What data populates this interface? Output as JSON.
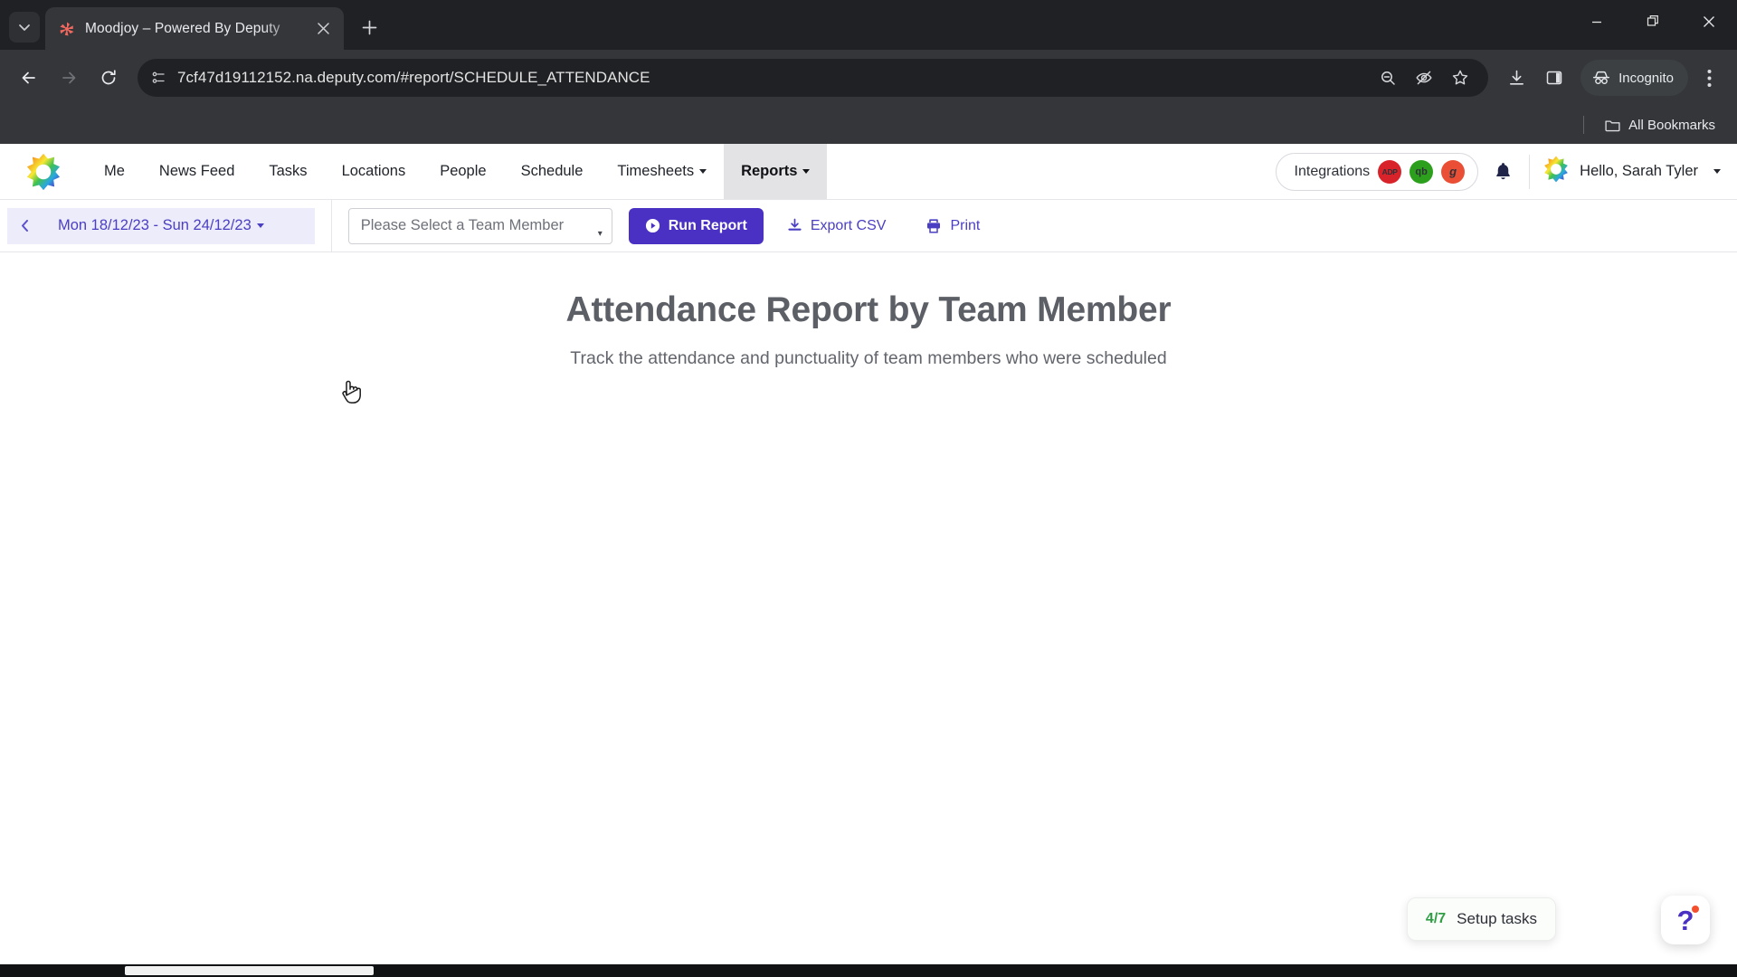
{
  "browser": {
    "tab": {
      "title": "Moodjoy – Powered By Deputy",
      "favicon": "moodjoy-pinwheel-icon",
      "close_label": "×"
    },
    "tab_list_icon": "chevron-down-icon",
    "new_tab_label": "+",
    "window_controls": {
      "minimize": "minimize-icon",
      "maximize": "restore-icon",
      "close": "close-icon"
    },
    "nav": {
      "back": "back-arrow-icon",
      "forward": "forward-arrow-icon",
      "reload": "reload-icon"
    },
    "omnibox": {
      "site_icon": "page-info-icon",
      "url": "7cf47d19112152.na.deputy.com/#report/SCHEDULE_ATTENDANCE",
      "actions": [
        "zoom-out-icon",
        "eye-slash-icon",
        "bookmark-star-icon"
      ]
    },
    "toolbar_actions": [
      "download-icon",
      "side-panel-icon"
    ],
    "profile": {
      "label": "Incognito",
      "icon": "incognito-icon"
    },
    "menu_icon": "three-dots-menu-icon",
    "bookmarks": {
      "folder_icon": "folder-icon",
      "label": "All Bookmarks"
    }
  },
  "app": {
    "logo": "moodjoy-rainbow-star-logo",
    "nav_items": [
      {
        "label": "Me",
        "active": false,
        "has_caret": false
      },
      {
        "label": "News Feed",
        "active": false,
        "has_caret": false
      },
      {
        "label": "Tasks",
        "active": false,
        "has_caret": false
      },
      {
        "label": "Locations",
        "active": false,
        "has_caret": false
      },
      {
        "label": "People",
        "active": false,
        "has_caret": false
      },
      {
        "label": "Schedule",
        "active": false,
        "has_caret": false
      },
      {
        "label": "Timesheets",
        "active": false,
        "has_caret": true
      },
      {
        "label": "Reports",
        "active": true,
        "has_caret": true
      }
    ],
    "integrations": {
      "label": "Integrations",
      "badges": [
        {
          "name": "adp-badge",
          "text": "ADP",
          "color": "#d8232a"
        },
        {
          "name": "quickbooks-badge",
          "text": "qb",
          "color": "#2ca01c"
        },
        {
          "name": "gusto-badge",
          "text": "g",
          "color": "#ea4f35"
        }
      ]
    },
    "notifications_icon": "bell-icon",
    "user": {
      "greeting": "Hello, Sarah Tyler",
      "avatar": "user-avatar-star"
    }
  },
  "report_toolbar": {
    "prev_icon": "chevron-left-icon",
    "next_icon": "chevron-right-icon",
    "date_range": "Mon 18/12/23 - Sun 24/12/23",
    "team_member_select": {
      "placeholder": "Please Select a Team Member",
      "value": ""
    },
    "buttons": [
      {
        "name": "run-report-button",
        "label": "Run Report",
        "icon": "play-circle-icon"
      },
      {
        "name": "export-csv-button",
        "label": "Export CSV",
        "icon": "download-icon"
      },
      {
        "name": "print-button",
        "label": "Print",
        "icon": "printer-icon"
      }
    ]
  },
  "report": {
    "title": "Attendance Report by Team Member",
    "subtitle": "Track the attendance and punctuality of team members who were scheduled"
  },
  "widgets": {
    "setup_tasks": {
      "count": "4/7",
      "label": "Setup tasks"
    },
    "help": {
      "glyph": "?",
      "name": "help-button"
    }
  },
  "colors": {
    "brand_purple": "#4a31c4",
    "link_purple": "#4a3fc3",
    "date_bg": "#edecfb",
    "success_green": "#2f9e44",
    "browser_dark": "#35363a"
  }
}
